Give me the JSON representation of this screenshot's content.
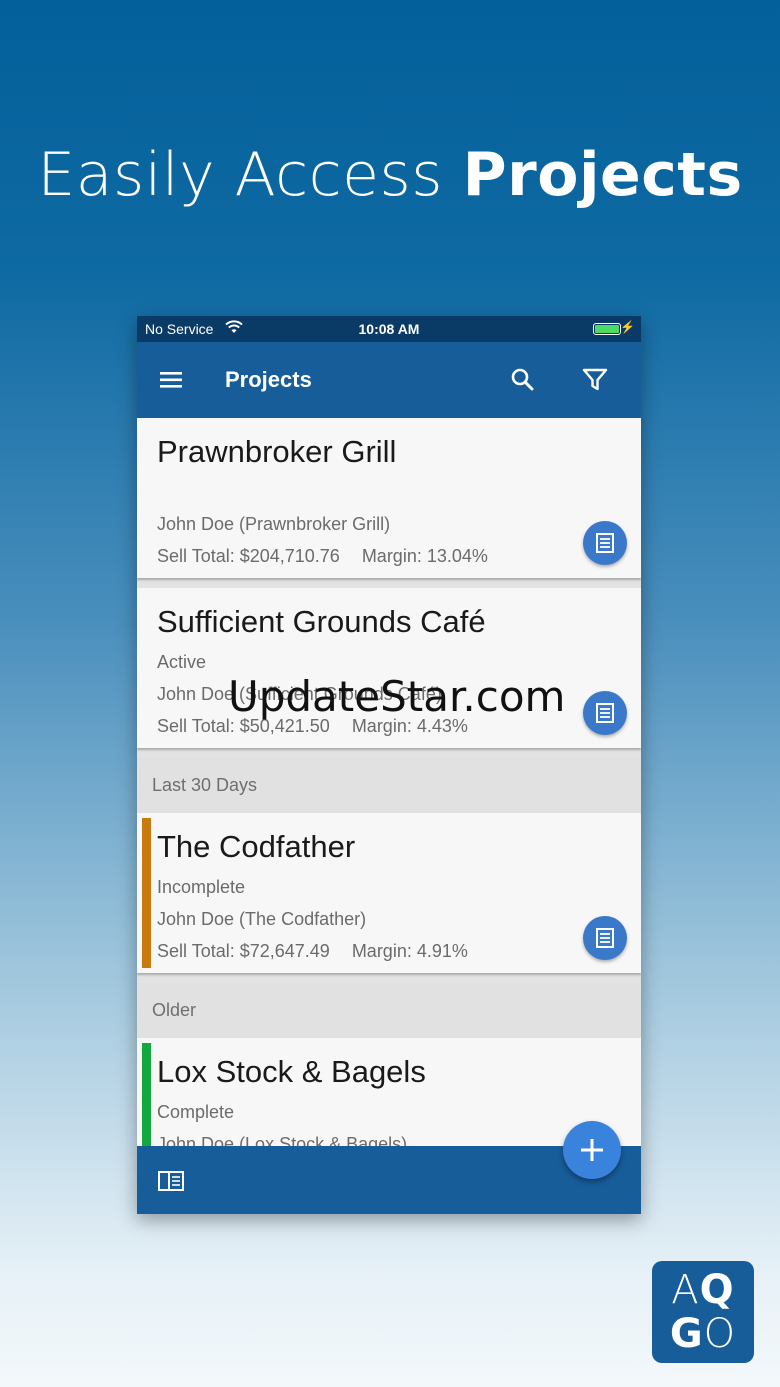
{
  "headline": {
    "light": "Easily Access ",
    "bold": "Projects"
  },
  "statusbar": {
    "carrier": "No Service",
    "time": "10:08 AM"
  },
  "toolbar": {
    "title": "Projects",
    "menu_icon": "hamburger-menu-icon",
    "search_icon": "search-icon",
    "filter_icon": "filter-icon"
  },
  "projects": [
    {
      "name": "Prawnbroker Grill",
      "status": "",
      "contact": "John Doe (Prawnbroker Grill)",
      "sell_total": "Sell Total: $204,710.76",
      "margin": "Margin: 13.04%"
    },
    {
      "name": "Sufficient Grounds Café",
      "status": "Active",
      "contact": "John Doe (Sufficient Grounds Café)",
      "sell_total": "Sell Total: $50,421.50",
      "margin": "Margin: 4.43%"
    },
    {
      "name": "The Codfather",
      "status": "Incomplete",
      "contact": "John Doe (The Codfather)",
      "sell_total": "Sell Total: $72,647.49",
      "margin": "Margin: 4.91%",
      "accent_color": "#c87a0e"
    },
    {
      "name": "Lox Stock & Bagels",
      "status": "Complete",
      "contact": "John Doe (Lox Stock & Bagels)",
      "accent_color": "#12a83c"
    }
  ],
  "sections": {
    "recent": "Last 30 Days",
    "older": "Older"
  },
  "watermark": "UpdateStar.com",
  "logo": {
    "top_left": "A",
    "top_right": "Q",
    "bottom_left": "G",
    "bottom_right": "O"
  },
  "colors": {
    "brand": "#175d9a",
    "fab": "#3a83dd",
    "doc_button": "#3a78c9"
  }
}
